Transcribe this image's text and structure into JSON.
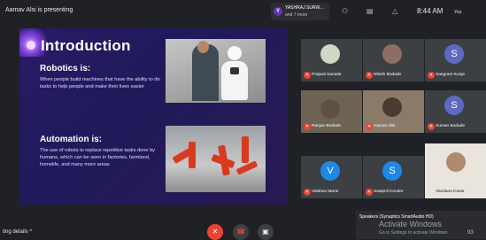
{
  "topbar": {
    "presenting": "Aamav Alsi is presenting",
    "notification": {
      "initial": "Y",
      "name": "YASHRAJ SURW...",
      "more": "and 7 more"
    },
    "time": "8:44 AM",
    "you_label": "You"
  },
  "slide": {
    "title": "Introduction",
    "robotics_heading": "Robotics is:",
    "robotics_body": "When people build machines that have the ability to do tasks to help people and make their lives easier",
    "automation_heading": "Automation is:",
    "automation_body": "The use of robots to replace repetitive tasks done by humans, which can be seen in factories, farmland, homelife, and many more areas"
  },
  "participants": [
    {
      "name": "Prajwal Sanade",
      "avatar": "",
      "avatar_color": "#cfd8c4"
    },
    {
      "name": "Nilesh Bodade",
      "avatar": "",
      "avatar_color": "#8d6e63"
    },
    {
      "name": "Sangram Kunje",
      "avatar": "S",
      "avatar_color": "#5c6bc0"
    },
    {
      "name": "Ranjan Bodade",
      "avatar": "",
      "avatar_color": "#5f5046"
    },
    {
      "name": "Aarvan Alsi",
      "avatar": "",
      "avatar_color": "#7a6a5a"
    },
    {
      "name": "Suman Bodade",
      "avatar": "S",
      "avatar_color": "#5c6bc0"
    },
    {
      "name": "Vaibhav Mane",
      "avatar": "V",
      "avatar_color": "#1e88e5"
    },
    {
      "name": "Swapnil Kendre",
      "avatar": "S",
      "avatar_color": "#1e88e5"
    },
    {
      "name": "Vandana Kasar",
      "avatar": "",
      "avatar_color": "#d7c9b8"
    }
  ],
  "bottombar": {
    "meeting_details": "ting details",
    "speakers": "Speakers (Synaptics SmartAudio HD)",
    "activate_title": "Activate Windows",
    "activate_sub": "Go to Settings to activate Windows",
    "tray_number": "93"
  },
  "colors": {
    "end_call": "#ea4335",
    "mic_off": "#ea4335",
    "slide_bg": "#241a5c"
  }
}
